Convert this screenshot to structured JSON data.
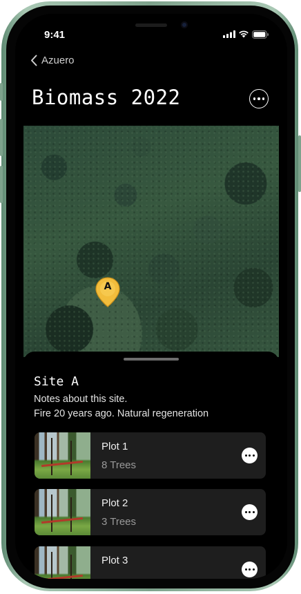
{
  "status_bar": {
    "time": "9:41"
  },
  "nav": {
    "back_label": "Azuero"
  },
  "page": {
    "title": "Biomass 2022"
  },
  "map": {
    "marker_label": "A",
    "marker_color": "#f2bd3c"
  },
  "site": {
    "title": "Site A",
    "note_line_1": "Notes about this site.",
    "note_line_2": "Fire 20 years ago. Natural regeneration"
  },
  "plots": [
    {
      "name": "Plot 1",
      "trees": "8 Trees"
    },
    {
      "name": "Plot 2",
      "trees": "3 Trees"
    },
    {
      "name": "Plot 3",
      "trees": ""
    }
  ],
  "icons": {
    "back": "chevron-left-icon",
    "more": "ellipsis-circle-icon",
    "signal": "cellular-signal-icon",
    "wifi": "wifi-icon",
    "battery": "battery-icon"
  }
}
